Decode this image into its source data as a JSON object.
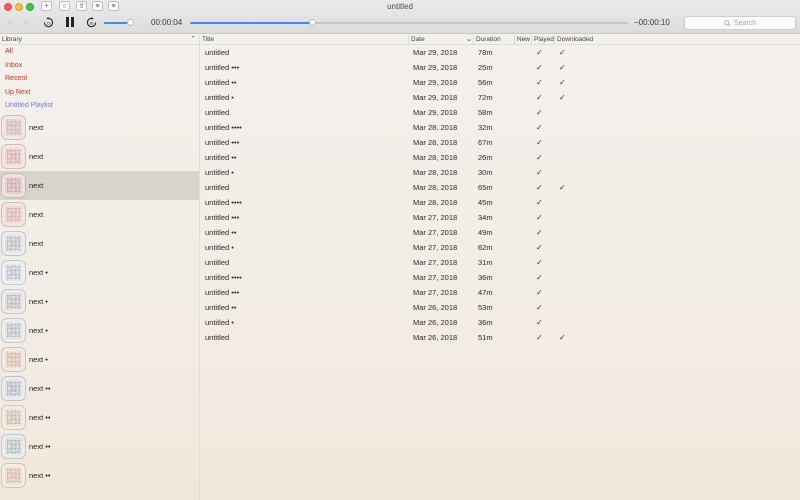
{
  "window": {
    "title": "untitled"
  },
  "toolbar": {
    "buttons": [
      {
        "name": "add-icon",
        "glyph": "+"
      },
      {
        "name": "refresh-icon",
        "glyph": "○"
      },
      {
        "name": "share-icon",
        "glyph": "⇪"
      },
      {
        "name": "list-icon",
        "glyph": "≡"
      },
      {
        "name": "menu-icon",
        "glyph": "≡"
      }
    ],
    "skip_back_label": "",
    "elapsed": "00:00:04",
    "remaining": "−00:00:10",
    "progress_fraction": 0.28,
    "volume_fraction": 0.9,
    "search_placeholder": "Search"
  },
  "sidebar": {
    "header": "Library",
    "library_items": [
      {
        "label": "All",
        "type": "smart"
      },
      {
        "label": "Inbox",
        "type": "smart"
      },
      {
        "label": "Recent",
        "type": "smart"
      },
      {
        "label": "Up Next",
        "type": "smart"
      },
      {
        "label": "Untitled Playlist",
        "type": "playlist"
      }
    ],
    "podcasts": [
      {
        "label": "next",
        "color": "#e9dcd8",
        "stroke": "#c9a6a0"
      },
      {
        "label": "next",
        "color": "#f0d9d9",
        "stroke": "#d49a9a"
      },
      {
        "label": "next",
        "color": "#e6d2d2",
        "stroke": "#c79a9a",
        "selected": true
      },
      {
        "label": "next",
        "color": "#efd8d8",
        "stroke": "#d9a0a0"
      },
      {
        "label": "next",
        "color": "#e2e2e4",
        "stroke": "#a9abb0"
      },
      {
        "label": "next •",
        "color": "#e4e6ea",
        "stroke": "#a6acb8"
      },
      {
        "label": "next •",
        "color": "#e3e2e2",
        "stroke": "#aaa6a6"
      },
      {
        "label": "next •",
        "color": "#e2e3e6",
        "stroke": "#a8abb3"
      },
      {
        "label": "next •",
        "color": "#ece0d8",
        "stroke": "#c9a995"
      },
      {
        "label": "next ••",
        "color": "#dee2e5",
        "stroke": "#9ea6ad"
      },
      {
        "label": "next ••",
        "color": "#ede2d6",
        "stroke": "#c9aa8c"
      },
      {
        "label": "next ••",
        "color": "#dfe4e4",
        "stroke": "#9fadab"
      },
      {
        "label": "next ••",
        "color": "#eee0d6",
        "stroke": "#cfa98f"
      }
    ]
  },
  "table": {
    "columns": {
      "title": "Title",
      "date": "Date",
      "duration": "Duration",
      "new": "New",
      "played": "Played",
      "downloaded": "Downloaded"
    },
    "rows": [
      {
        "title": "untitled",
        "date": "Mar 29, 2018",
        "duration": "78m",
        "played": "✓",
        "downloaded": "✓"
      },
      {
        "title": "untitled •••",
        "date": "Mar 29, 2018",
        "duration": "25m",
        "played": "✓",
        "downloaded": "✓"
      },
      {
        "title": "untitled ••",
        "date": "Mar 29, 2018",
        "duration": "56m",
        "played": "✓",
        "downloaded": "✓"
      },
      {
        "title": "untitled •",
        "date": "Mar 29, 2018",
        "duration": "72m",
        "played": "✓",
        "downloaded": "✓"
      },
      {
        "title": "untitled",
        "date": "Mar 29, 2018",
        "duration": "58m",
        "played": "✓",
        "downloaded": ""
      },
      {
        "title": "untitled ••••",
        "date": "Mar 28, 2018",
        "duration": "32m",
        "played": "✓",
        "downloaded": ""
      },
      {
        "title": "untitled •••",
        "date": "Mar 28, 2018",
        "duration": "67m",
        "played": "✓",
        "downloaded": ""
      },
      {
        "title": "untitled ••",
        "date": "Mar 28, 2018",
        "duration": "26m",
        "played": "✓",
        "downloaded": ""
      },
      {
        "title": "untitled •",
        "date": "Mar 28, 2018",
        "duration": "30m",
        "played": "✓",
        "downloaded": ""
      },
      {
        "title": "untitled",
        "date": "Mar 28, 2018",
        "duration": "65m",
        "played": "✓",
        "downloaded": "✓"
      },
      {
        "title": "untitled ••••",
        "date": "Mar 28, 2018",
        "duration": "45m",
        "played": "✓",
        "downloaded": ""
      },
      {
        "title": "untitled •••",
        "date": "Mar 27, 2018",
        "duration": "34m",
        "played": "✓",
        "downloaded": ""
      },
      {
        "title": "untitled ••",
        "date": "Mar 27, 2018",
        "duration": "49m",
        "played": "✓",
        "downloaded": ""
      },
      {
        "title": "untitled •",
        "date": "Mar 27, 2018",
        "duration": "62m",
        "played": "✓",
        "downloaded": ""
      },
      {
        "title": "untitled",
        "date": "Mar 27, 2018",
        "duration": "31m",
        "played": "✓",
        "downloaded": ""
      },
      {
        "title": "untitled ••••",
        "date": "Mar 27, 2018",
        "duration": "36m",
        "played": "✓",
        "downloaded": ""
      },
      {
        "title": "untitled •••",
        "date": "Mar 27, 2018",
        "duration": "47m",
        "played": "✓",
        "downloaded": ""
      },
      {
        "title": "untitled ••",
        "date": "Mar 26, 2018",
        "duration": "53m",
        "played": "✓",
        "downloaded": ""
      },
      {
        "title": "untitled •",
        "date": "Mar 26, 2018",
        "duration": "36m",
        "played": "✓",
        "downloaded": ""
      },
      {
        "title": "untitled",
        "date": "Mar 26, 2018",
        "duration": "51m",
        "played": "✓",
        "downloaded": "✓"
      }
    ]
  },
  "colors": {
    "accent": "#3b8ef5",
    "library_text": "#c0392b",
    "playlist_text": "#7d73d6",
    "selected_row": "#d8d3cc"
  }
}
